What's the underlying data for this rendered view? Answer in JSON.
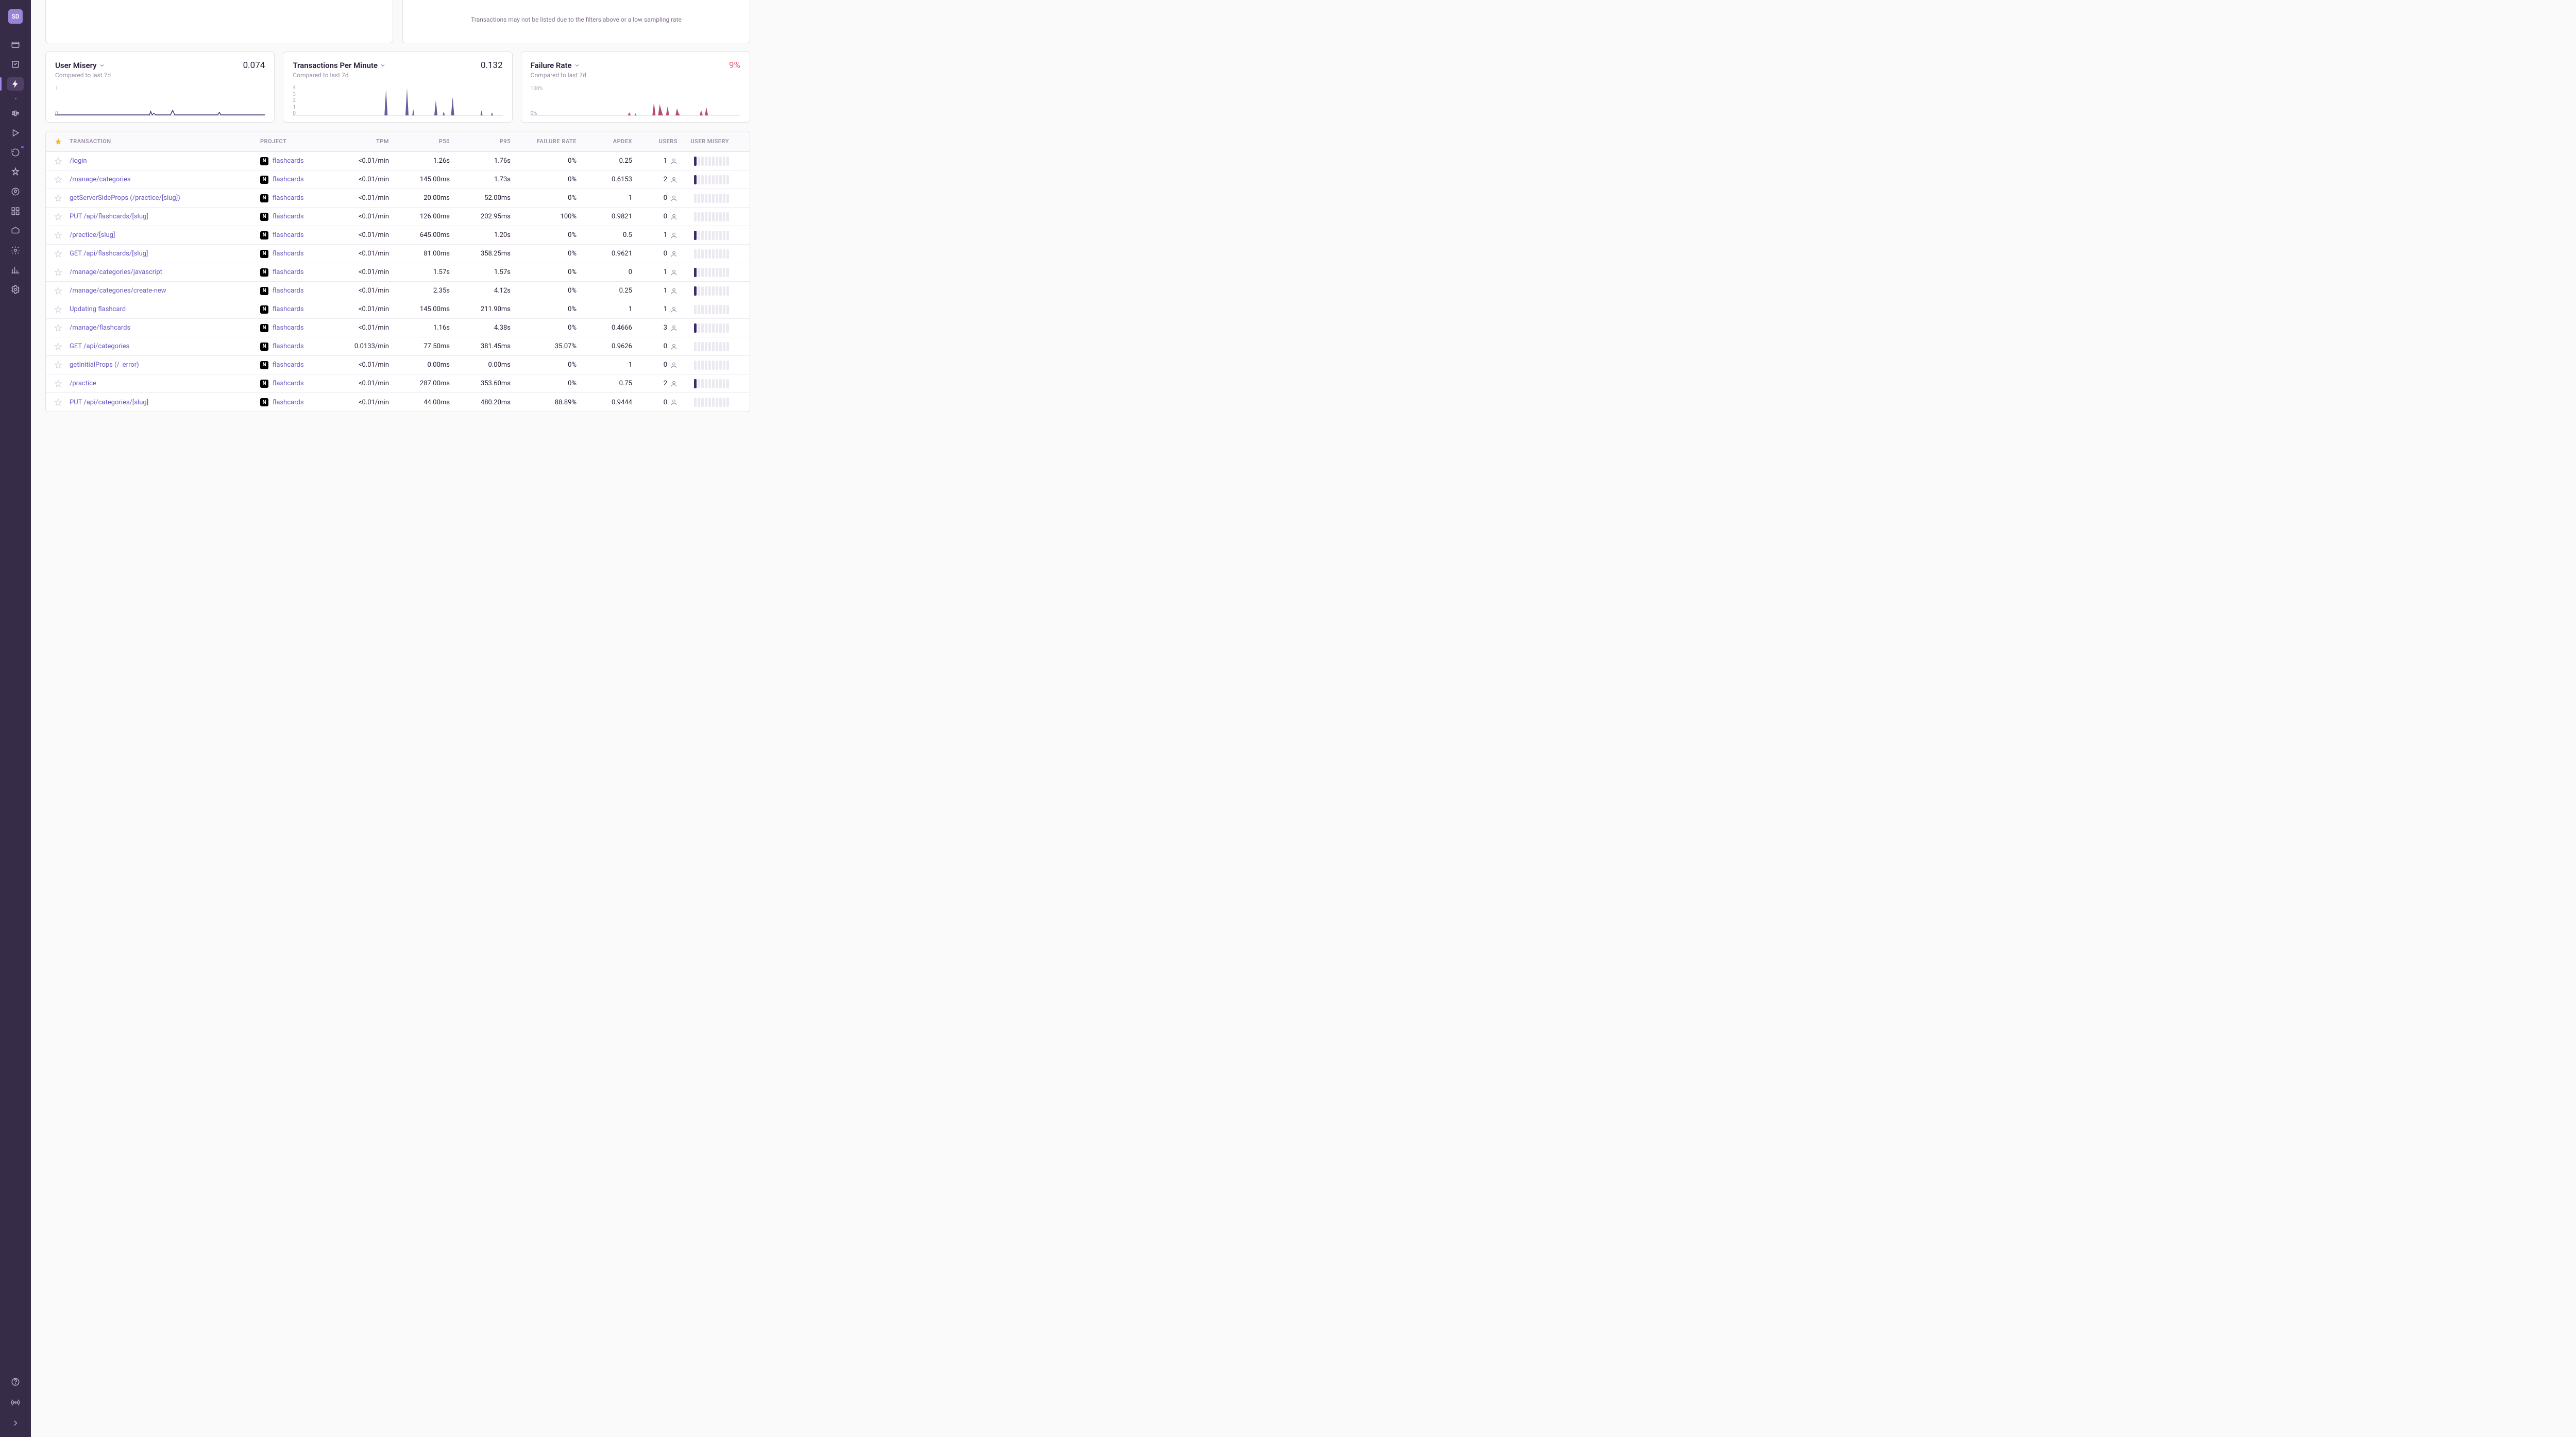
{
  "sidebar": {
    "initials": "SD"
  },
  "info_card_text": "Transactions may not be listed due to the filters above or a low sampling rate",
  "metrics": {
    "misery": {
      "title": "User Misery",
      "subtitle": "Compared to last 7d",
      "value": "0.074",
      "y_top": "1",
      "y_bottom": "0"
    },
    "tpm": {
      "title": "Transactions Per Minute",
      "subtitle": "Compared to last 7d",
      "value": "0.132",
      "y_labels": [
        "4",
        "3",
        "2",
        "1",
        "0"
      ]
    },
    "failure": {
      "title": "Failure Rate",
      "subtitle": "Compared to last 7d",
      "value": "9%",
      "y_top": "100%",
      "y_bottom": "0%"
    }
  },
  "headers": {
    "transaction": "Transaction",
    "project": "Project",
    "tpm": "TPM",
    "p50": "P50",
    "p95": "P95",
    "failure": "Failure Rate",
    "apdex": "Apdex",
    "users": "Users",
    "misery": "User Misery"
  },
  "rows": [
    {
      "tx": "/login",
      "tpm": "<0.01/min",
      "p50": "1.26s",
      "p95": "1.76s",
      "fail": "0%",
      "apdex": "0.25",
      "users": "1",
      "misery_on": 1
    },
    {
      "tx": "/manage/categories",
      "tpm": "<0.01/min",
      "p50": "145.00ms",
      "p95": "1.73s",
      "fail": "0%",
      "apdex": "0.6153",
      "users": "2",
      "misery_on": 1
    },
    {
      "tx": "getServerSideProps (/practice/[slug])",
      "tpm": "<0.01/min",
      "p50": "20.00ms",
      "p95": "52.00ms",
      "fail": "0%",
      "apdex": "1",
      "users": "0",
      "misery_on": 0
    },
    {
      "tx": "PUT /api/flashcards/[slug]",
      "tpm": "<0.01/min",
      "p50": "126.00ms",
      "p95": "202.95ms",
      "fail": "100%",
      "apdex": "0.9821",
      "users": "0",
      "misery_on": 0
    },
    {
      "tx": "/practice/[slug]",
      "tpm": "<0.01/min",
      "p50": "645.00ms",
      "p95": "1.20s",
      "fail": "0%",
      "apdex": "0.5",
      "users": "1",
      "misery_on": 1
    },
    {
      "tx": "GET /api/flashcards/[slug]",
      "tpm": "<0.01/min",
      "p50": "81.00ms",
      "p95": "358.25ms",
      "fail": "0%",
      "apdex": "0.9621",
      "users": "0",
      "misery_on": 0
    },
    {
      "tx": "/manage/categories/javascript",
      "tpm": "<0.01/min",
      "p50": "1.57s",
      "p95": "1.57s",
      "fail": "0%",
      "apdex": "0",
      "users": "1",
      "misery_on": 1
    },
    {
      "tx": "/manage/categories/create-new",
      "tpm": "<0.01/min",
      "p50": "2.35s",
      "p95": "4.12s",
      "fail": "0%",
      "apdex": "0.25",
      "users": "1",
      "misery_on": 1
    },
    {
      "tx": "Updating flashcard",
      "tpm": "<0.01/min",
      "p50": "145.00ms",
      "p95": "211.90ms",
      "fail": "0%",
      "apdex": "1",
      "users": "1",
      "misery_on": 0
    },
    {
      "tx": "/manage/flashcards",
      "tpm": "<0.01/min",
      "p50": "1.16s",
      "p95": "4.38s",
      "fail": "0%",
      "apdex": "0.4666",
      "users": "3",
      "misery_on": 1
    },
    {
      "tx": "GET /api/categories",
      "tpm": "0.0133/min",
      "p50": "77.50ms",
      "p95": "381.45ms",
      "fail": "35.07%",
      "apdex": "0.9626",
      "users": "0",
      "misery_on": 0
    },
    {
      "tx": "getInitialProps (/_error)",
      "tpm": "<0.01/min",
      "p50": "0.00ms",
      "p95": "0.00ms",
      "fail": "0%",
      "apdex": "1",
      "users": "0",
      "misery_on": 0
    },
    {
      "tx": "/practice",
      "tpm": "<0.01/min",
      "p50": "287.00ms",
      "p95": "353.60ms",
      "fail": "0%",
      "apdex": "0.75",
      "users": "2",
      "misery_on": 1
    },
    {
      "tx": "PUT /api/categories/[slug]",
      "tpm": "<0.01/min",
      "p50": "44.00ms",
      "p95": "480.20ms",
      "fail": "88.89%",
      "apdex": "0.9444",
      "users": "0",
      "misery_on": 0
    }
  ],
  "project_name": "flashcards"
}
